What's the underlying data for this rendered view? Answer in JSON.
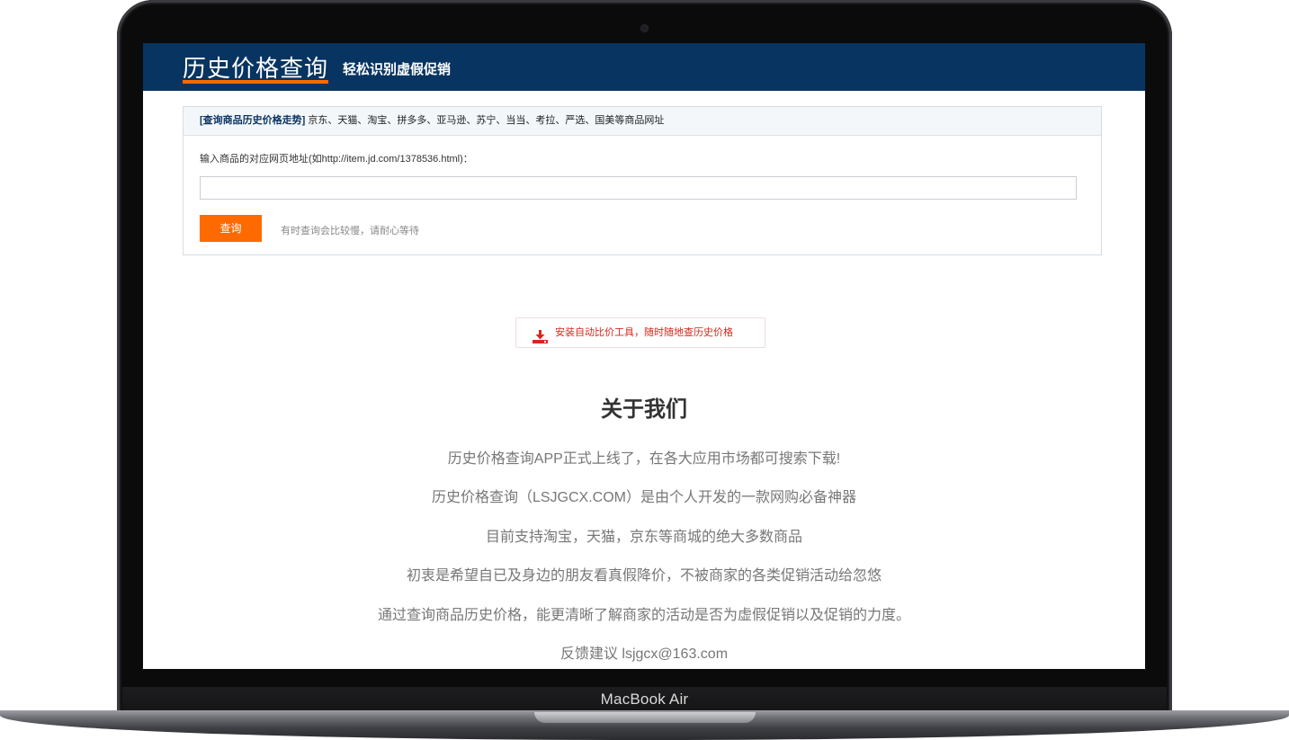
{
  "device": {
    "label": "MacBook Air"
  },
  "header": {
    "logo": "历史价格查询",
    "tagline": "轻松识别虚假促销",
    "bg_color": "#083461",
    "accent_color": "#ff6a00"
  },
  "search_panel": {
    "head_bold": "[查询商品历史价格走势]",
    "head_text": " 京东、天猫、淘宝、拼多多、亚马逊、苏宁、当当、考拉、严选、国美等商品网址",
    "input_label": "输入商品的对应网页地址(如http://item.jd.com/1378536.html)：",
    "input_value": "",
    "input_placeholder": "",
    "button_label": "查询",
    "hint": "有时查询会比较慢，请耐心等待"
  },
  "install": {
    "icon": "download-icon",
    "label": "安装自动比价工具，随时随地查历史价格",
    "color": "#d9261c"
  },
  "about": {
    "title": "关于我们",
    "lines": [
      "历史价格查询APP正式上线了，在各大应用市场都可搜索下载!",
      "历史价格查询（LSJGCX.COM）是由个人开发的一款网购必备神器",
      "目前支持淘宝，天猫，京东等商城的绝大多数商品",
      "初衷是希望自已及身边的朋友看真假降价，不被商家的各类促销活动给忽悠",
      "通过查询商品历史价格，能更清晰了解商家的活动是否为虚假促销以及促销的力度。",
      "反馈建议 lsjgcx@163.com"
    ]
  }
}
